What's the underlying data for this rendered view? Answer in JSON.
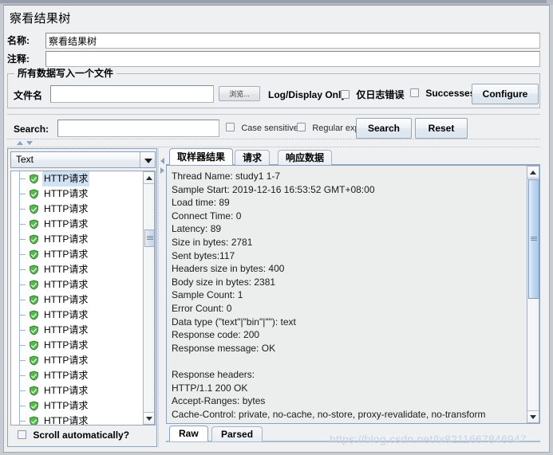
{
  "window": {
    "panel_title": "察看结果树"
  },
  "form": {
    "name_label": "名称:",
    "name_value": "察看结果树",
    "comment_label": "注释:",
    "comment_value": "",
    "file_group_title": "所有数据写入一个文件",
    "filename_label": "文件名",
    "filename_value": "",
    "browse_button": "浏览...",
    "log_display_label": "Log/Display Only:",
    "errors_only_label": "仅日志错误",
    "errors_only_checked": false,
    "successes_label": "Successes",
    "successes_checked": false,
    "configure_button": "Configure"
  },
  "search": {
    "label": "Search:",
    "value": "",
    "case_sensitive_label": "Case sensitive",
    "case_sensitive_checked": false,
    "regular_exp_label": "Regular exp.",
    "regular_exp_checked": false,
    "search_button": "Search",
    "reset_button": "Reset"
  },
  "tree_panel": {
    "renderer_selected": "Text",
    "renderer_options": [
      "Text"
    ],
    "scroll_auto_label": "Scroll automatically?",
    "scroll_auto_checked": false,
    "items": [
      {
        "label": "HTTP请求",
        "status": "success",
        "selected": true
      },
      {
        "label": "HTTP请求",
        "status": "success",
        "selected": false
      },
      {
        "label": "HTTP请求",
        "status": "success",
        "selected": false
      },
      {
        "label": "HTTP请求",
        "status": "success",
        "selected": false
      },
      {
        "label": "HTTP请求",
        "status": "success",
        "selected": false
      },
      {
        "label": "HTTP请求",
        "status": "success",
        "selected": false
      },
      {
        "label": "HTTP请求",
        "status": "success",
        "selected": false
      },
      {
        "label": "HTTP请求",
        "status": "success",
        "selected": false
      },
      {
        "label": "HTTP请求",
        "status": "success",
        "selected": false
      },
      {
        "label": "HTTP请求",
        "status": "success",
        "selected": false
      },
      {
        "label": "HTTP请求",
        "status": "success",
        "selected": false
      },
      {
        "label": "HTTP请求",
        "status": "success",
        "selected": false
      },
      {
        "label": "HTTP请求",
        "status": "success",
        "selected": false
      },
      {
        "label": "HTTP请求",
        "status": "success",
        "selected": false
      },
      {
        "label": "HTTP请求",
        "status": "success",
        "selected": false
      },
      {
        "label": "HTTP请求",
        "status": "success",
        "selected": false
      },
      {
        "label": "HTTP请求",
        "status": "success",
        "selected": false
      }
    ]
  },
  "results": {
    "tabs": [
      {
        "label": "取样器结果",
        "active": true
      },
      {
        "label": "请求",
        "active": false
      },
      {
        "label": "响应数据",
        "active": false
      }
    ],
    "bottom_tabs": [
      {
        "label": "Raw",
        "active": true
      },
      {
        "label": "Parsed",
        "active": false
      }
    ],
    "lines": [
      "Thread Name: study1 1-7",
      "Sample Start: 2019-12-16 16:53:52 GMT+08:00",
      "Load time: 89",
      "Connect Time: 0",
      "Latency: 89",
      "Size in bytes: 2781",
      "Sent bytes:117",
      "Headers size in bytes: 400",
      "Body size in bytes: 2381",
      "Sample Count: 1",
      "Error Count: 0",
      "Data type (\"text\"|\"bin\"|\"\"): text",
      "Response code: 200",
      "Response message: OK",
      "",
      "Response headers:",
      "HTTP/1.1 200 OK",
      "Accept-Ranges: bytes",
      "Cache-Control: private, no-cache, no-store, proxy-revalidate, no-transform"
    ]
  },
  "watermark": {
    "text": "https://blog.csdn.net/lx8211667846947"
  },
  "colors": {
    "status_success": "#43a047",
    "selection": "#cfe1f4",
    "panel_bg": "#eef0f1",
    "accent_border": "#8fa3c0"
  }
}
